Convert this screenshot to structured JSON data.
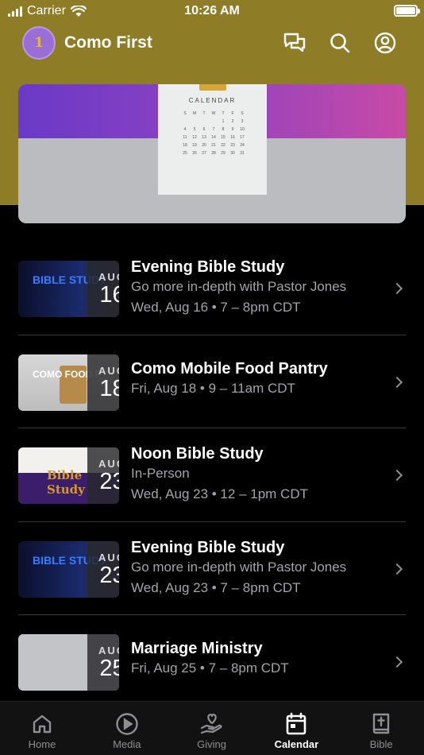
{
  "status_bar": {
    "carrier": "Carrier",
    "time": "10:26 AM"
  },
  "header": {
    "app_title": "Como First",
    "avatar_initials": "1"
  },
  "banner": {
    "calendar_title": "CALENDAR",
    "weekday_letters": [
      "S",
      "M",
      "T",
      "W",
      "T",
      "F",
      "S"
    ],
    "days": [
      "",
      "",
      "",
      "",
      "1",
      "2",
      "3",
      "4",
      "5",
      "6",
      "7",
      "8",
      "9",
      "10",
      "11",
      "12",
      "13",
      "14",
      "15",
      "16",
      "17",
      "18",
      "19",
      "20",
      "21",
      "22",
      "23",
      "24",
      "25",
      "26",
      "27",
      "28",
      "29",
      "30",
      "31"
    ]
  },
  "events": [
    {
      "month": "AUG",
      "day": "16",
      "title": "Evening Bible Study",
      "subtitle": "Go more in-depth with Pastor Jones",
      "when": "Wed, Aug 16 • 7 – 8pm CDT",
      "thumb_text": "BIBLE STUDY"
    },
    {
      "month": "AUG",
      "day": "18",
      "title": "Como Mobile Food Pantry",
      "subtitle": "",
      "when": "Fri, Aug 18 • 9 – 11am CDT",
      "thumb_text": "COMO FOOD P"
    },
    {
      "month": "AUG",
      "day": "23",
      "title": "Noon Bible Study",
      "subtitle": "In-Person",
      "when": "Wed, Aug 23 • 12 – 1pm CDT",
      "thumb_text": "Bible Study"
    },
    {
      "month": "AUG",
      "day": "23",
      "title": "Evening Bible Study",
      "subtitle": "Go more in-depth with Pastor Jones",
      "when": "Wed, Aug 23 • 7 – 8pm CDT",
      "thumb_text": "BIBLE STUDY"
    },
    {
      "month": "AUG",
      "day": "25",
      "title": "Marriage Ministry",
      "subtitle": "",
      "when": "Fri, Aug 25 • 7 – 8pm CDT",
      "thumb_text": ""
    }
  ],
  "tabs": [
    {
      "label": "Home",
      "icon": "home-icon"
    },
    {
      "label": "Media",
      "icon": "play-icon"
    },
    {
      "label": "Giving",
      "icon": "giving-icon"
    },
    {
      "label": "Calendar",
      "icon": "calendar-icon",
      "active": true
    },
    {
      "label": "Bible",
      "icon": "bible-icon"
    }
  ],
  "colors": {
    "header_bg": "#8e7d26",
    "accent_purple": "#7a3fc6",
    "accent_pink": "#c84aa7",
    "muted_text": "#a4a4a8"
  }
}
